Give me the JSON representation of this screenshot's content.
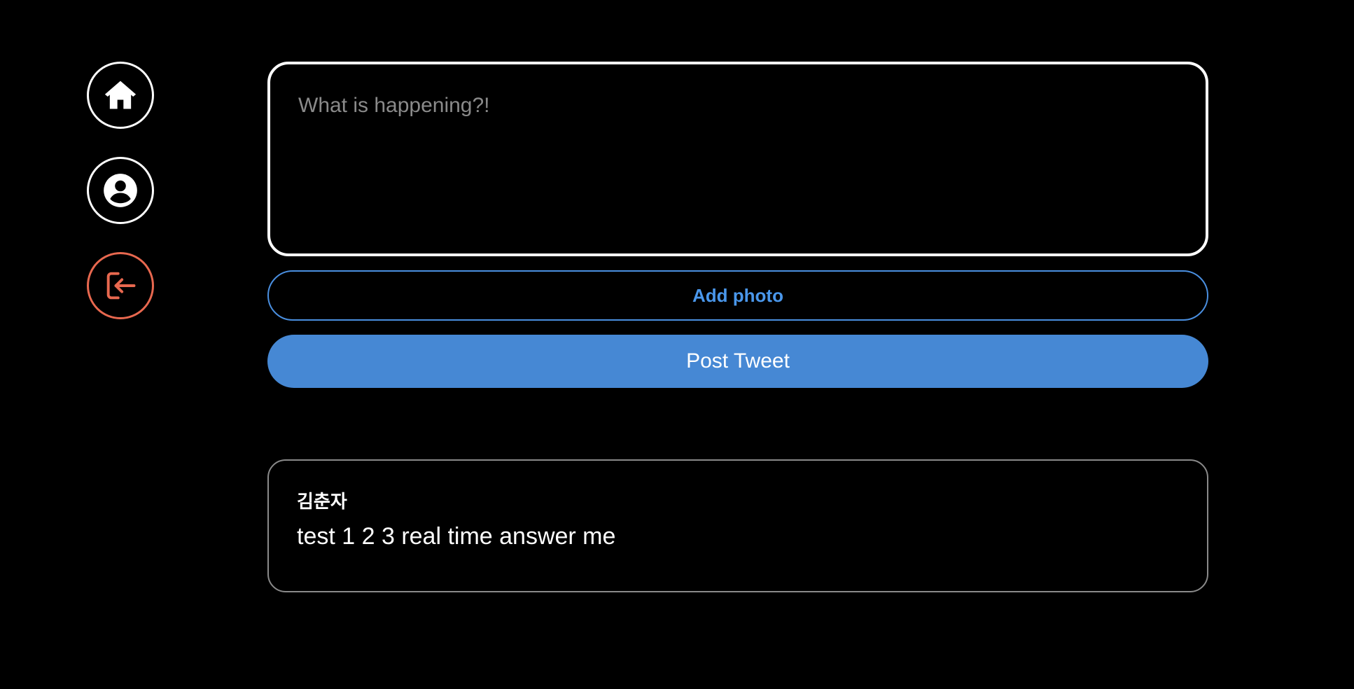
{
  "nav": {
    "items": [
      {
        "name": "home",
        "icon": "home-icon"
      },
      {
        "name": "profile",
        "icon": "user-icon"
      },
      {
        "name": "logout",
        "icon": "logout-icon",
        "color": "#e8684f"
      }
    ]
  },
  "compose": {
    "placeholder": "What is happening?!",
    "value": ""
  },
  "actions": {
    "add_photo_label": "Add photo",
    "post_label": "Post Tweet",
    "accent_color": "#4688d4"
  },
  "feed": {
    "tweets": [
      {
        "username": "김춘자",
        "text": "test 1 2 3 real time answer me"
      }
    ]
  }
}
